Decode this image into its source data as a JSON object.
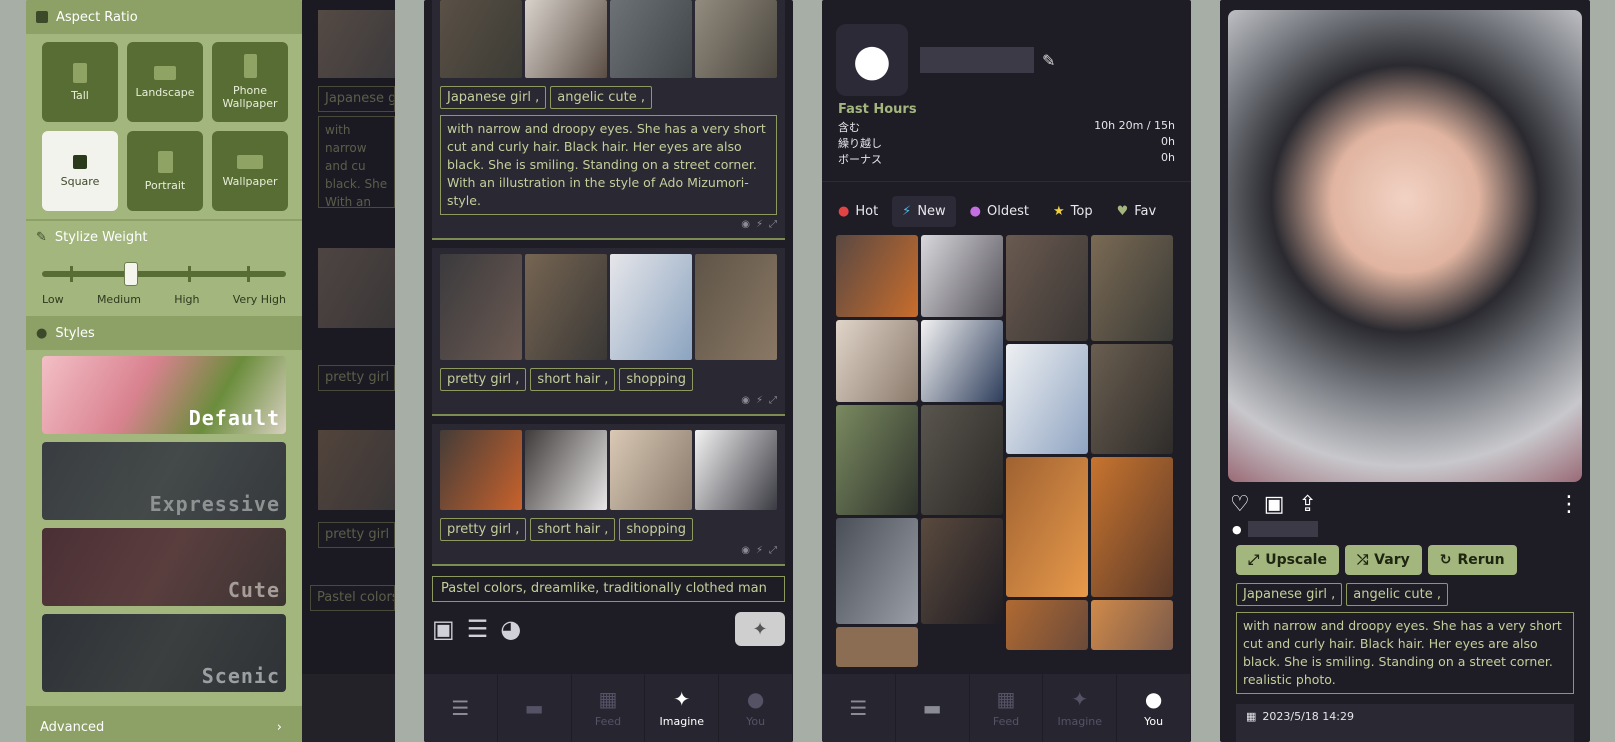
{
  "panel1": {
    "aspect_title": "Aspect Ratio",
    "aspect_options": [
      "Tall",
      "Landscape",
      "Phone Wallpaper",
      "Square",
      "Portrait",
      "Wallpaper"
    ],
    "selected": "Square",
    "stylize_title": "Stylize Weight",
    "stylize_labels": [
      "Low",
      "Medium",
      "High",
      "Very High"
    ],
    "stylize_value": "Medium",
    "styles_title": "Styles",
    "styles": [
      "Default",
      "Expressive",
      "Cute",
      "Scenic"
    ],
    "advanced": "Advanced"
  },
  "panel2": {
    "card1_tags": [
      "Japanese girl ,",
      "angelic cute ,"
    ],
    "card1_prompt": "with narrow and droopy eyes. She has a very short cut and curly hair. Black hair. Her eyes are also black. She is smiling. Standing on a street corner. With an illustration in the style of Ado Mizumori-style.",
    "card2_tags": [
      "pretty girl ,",
      "short hair ,",
      "shopping"
    ],
    "card3_tags": [
      "pretty girl ,",
      "short hair ,",
      "shopping"
    ],
    "input_value": "Pastel colors, dreamlike, traditionally clothed man",
    "nav": [
      "",
      "",
      "Feed",
      "Imagine",
      "You"
    ],
    "nav_active": "Imagine"
  },
  "ghost": {
    "tag1": "Japanese g",
    "prompt": "with narrow and cu black. She With an illu style.",
    "tag2": "pretty girl ,",
    "tag3": "pretty girl ,",
    "input": "Pastel colors"
  },
  "panel3": {
    "fast_hours": "Fast Hours",
    "rows": [
      {
        "label": "含む",
        "value": "10h 20m / 15h"
      },
      {
        "label": "繰り越し",
        "value": "0h"
      },
      {
        "label": "ボーナス",
        "value": "0h"
      }
    ],
    "tabs": [
      "Hot",
      "New",
      "Oldest",
      "Top",
      "Fav"
    ],
    "active_tab": "New",
    "nav": [
      "",
      "",
      "Feed",
      "Imagine",
      "You"
    ],
    "nav_active": "You"
  },
  "panel4": {
    "buttons": [
      "Upscale",
      "Vary",
      "Rerun"
    ],
    "tags": [
      "Japanese girl ,",
      "angelic cute ,"
    ],
    "prompt": "with narrow and droopy eyes. She has a very short cut and curly hair. Black hair. Her eyes are also black. She is smiling. Standing on a street corner. realistic photo.",
    "date": "2023/5/18 14:29"
  },
  "colors": {
    "accent": "#a3b67e",
    "dark": "#1e1c25"
  }
}
